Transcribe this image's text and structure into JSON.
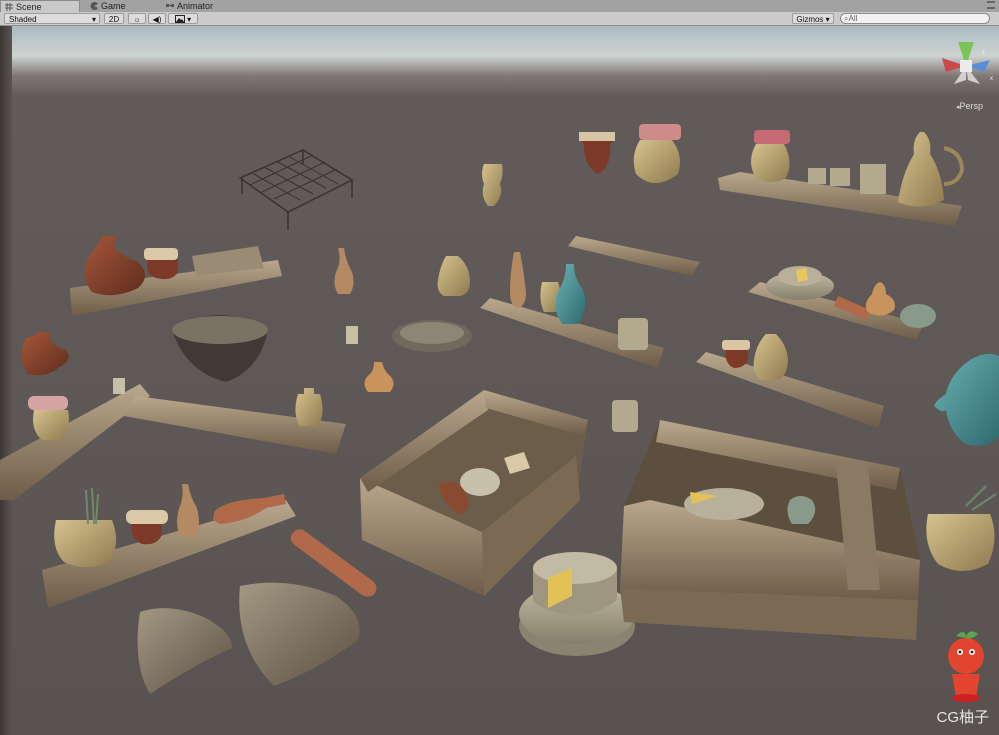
{
  "tabs": [
    {
      "label": "Scene",
      "icon": "grid-icon"
    },
    {
      "label": "Game",
      "icon": "pacman-icon"
    },
    {
      "label": "Animator",
      "icon": "animator-icon"
    }
  ],
  "toolbar": {
    "shading_mode": "Shaded",
    "mode_2d": "2D",
    "lighting_icon": "sun-icon",
    "audio_icon": "speaker-icon",
    "effects_icon": "image-icon",
    "gizmos_label": "Gizmos",
    "search_placeholder": "All"
  },
  "viewport": {
    "projection_label": "Persp",
    "gizmo_axes": [
      "x",
      "y",
      "z"
    ],
    "watermark": "CG柚子"
  },
  "colors": {
    "wood": "#8b7a63",
    "wood_light": "#b5a285",
    "clay": "#8a4a32",
    "teal": "#4f8c90",
    "ceramic": "#c9b07a",
    "cheese": "#a8a08a",
    "floor": "#5d5755"
  }
}
